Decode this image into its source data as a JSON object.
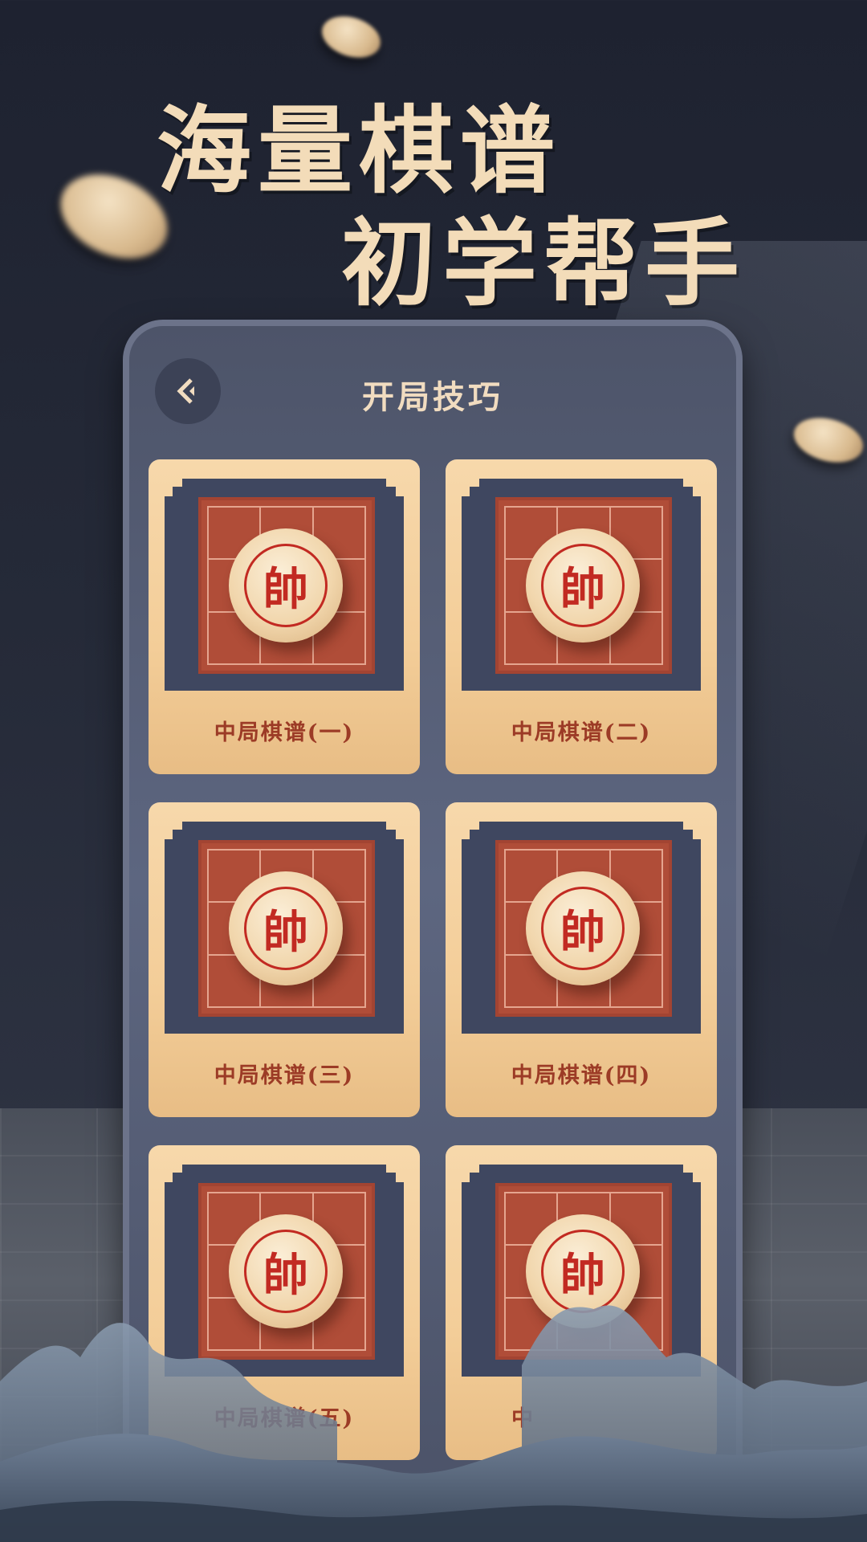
{
  "headline": {
    "line1": "海量棋谱",
    "line2": "初学帮手"
  },
  "screen": {
    "title": "开局技巧",
    "back_icon": "chevron-left-icon"
  },
  "cards": [
    {
      "label": "中局棋谱(一)",
      "piece": "帥"
    },
    {
      "label": "中局棋谱(二)",
      "piece": "帥"
    },
    {
      "label": "中局棋谱(三)",
      "piece": "帥"
    },
    {
      "label": "中局棋谱(四)",
      "piece": "帥"
    },
    {
      "label": "中局棋谱(五)",
      "piece": "帥"
    },
    {
      "label": "中",
      "piece": "帥"
    }
  ],
  "colors": {
    "headline": "#f3dcb9",
    "card_bg": "#f3cd98",
    "board": "#b04d38",
    "piece_text": "#c22a22",
    "label_text": "#9c3b26"
  }
}
